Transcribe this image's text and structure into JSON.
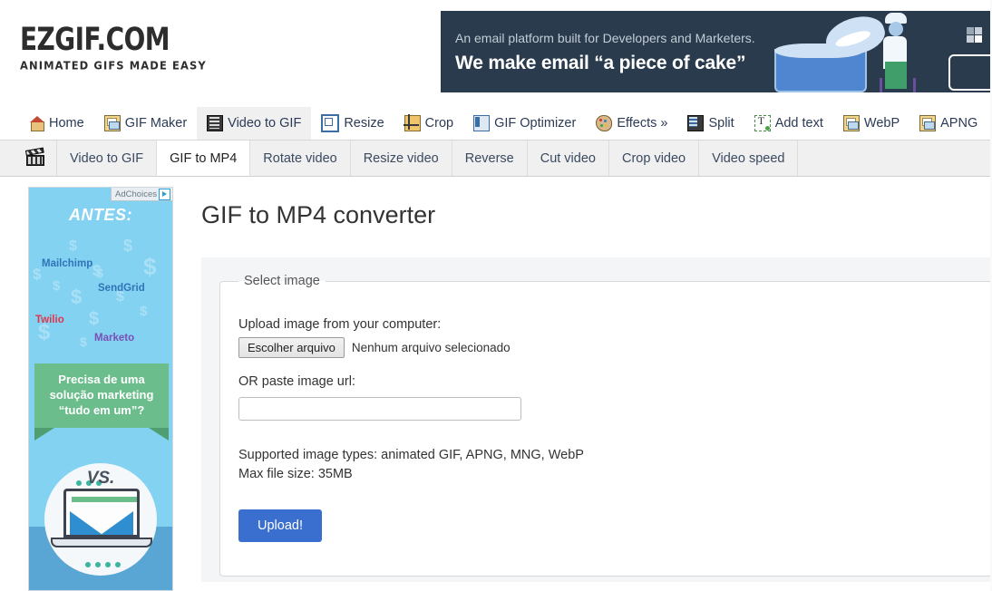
{
  "site": {
    "logo_main": "EZGIF.COM",
    "logo_sub": "ANIMATED GIFS MADE EASY"
  },
  "banner_ad": {
    "line1": "An email platform built for Developers and Marketers.",
    "line2": "We make email “a piece of cake”",
    "background_color": "#293b4d"
  },
  "main_nav": {
    "items": [
      {
        "label": "Home",
        "icon": "home-icon",
        "active": false
      },
      {
        "label": "GIF Maker",
        "icon": "images-icon",
        "active": false
      },
      {
        "label": "Video to GIF",
        "icon": "film-icon",
        "active": true
      },
      {
        "label": "Resize",
        "icon": "resize-icon",
        "active": false
      },
      {
        "label": "Crop",
        "icon": "crop-icon",
        "active": false
      },
      {
        "label": "GIF Optimizer",
        "icon": "optimizer-icon",
        "active": false
      },
      {
        "label": "Effects »",
        "icon": "palette-icon",
        "active": false
      },
      {
        "label": "Split",
        "icon": "split-icon",
        "active": false
      },
      {
        "label": "Add text",
        "icon": "add-text-icon",
        "active": false
      },
      {
        "label": "WebP",
        "icon": "images-icon",
        "active": false
      },
      {
        "label": "APNG",
        "icon": "images-icon",
        "active": false
      }
    ]
  },
  "sub_nav": {
    "icon": "clapperboard-icon",
    "items": [
      {
        "label": "Video to GIF",
        "active": false
      },
      {
        "label": "GIF to MP4",
        "active": true
      },
      {
        "label": "Rotate video",
        "active": false
      },
      {
        "label": "Resize video",
        "active": false
      },
      {
        "label": "Reverse",
        "active": false
      },
      {
        "label": "Cut video",
        "active": false
      },
      {
        "label": "Crop video",
        "active": false
      },
      {
        "label": "Video speed",
        "active": false
      }
    ]
  },
  "sidebar_ad": {
    "adchoices_label": "AdChoices",
    "headline": "ANTES:",
    "brands": [
      {
        "name": "Mailchimp",
        "color": "#2f73b8"
      },
      {
        "name": "SendGrid",
        "color": "#2f73b8"
      },
      {
        "name": "Twilio",
        "color": "#e0344a"
      },
      {
        "name": "Marketo",
        "color": "#7a4fb5"
      }
    ],
    "green_banner": "Precisa de uma solução marketing “tudo em um”?",
    "vs_label": "VS."
  },
  "main": {
    "page_title": "GIF to MP4 converter",
    "fieldset_legend": "Select image",
    "upload_label": "Upload image from your computer:",
    "file_button_label": "Escolher arquivo",
    "file_status": "Nenhum arquivo selecionado",
    "url_label": "OR paste image url:",
    "url_value": "",
    "url_placeholder": "",
    "supported_types": "Supported image types: animated GIF, APNG, MNG, WebP",
    "max_file_size": "Max file size: 35MB",
    "upload_button_label": "Upload!",
    "upload_button_color": "#3a6fd0"
  }
}
